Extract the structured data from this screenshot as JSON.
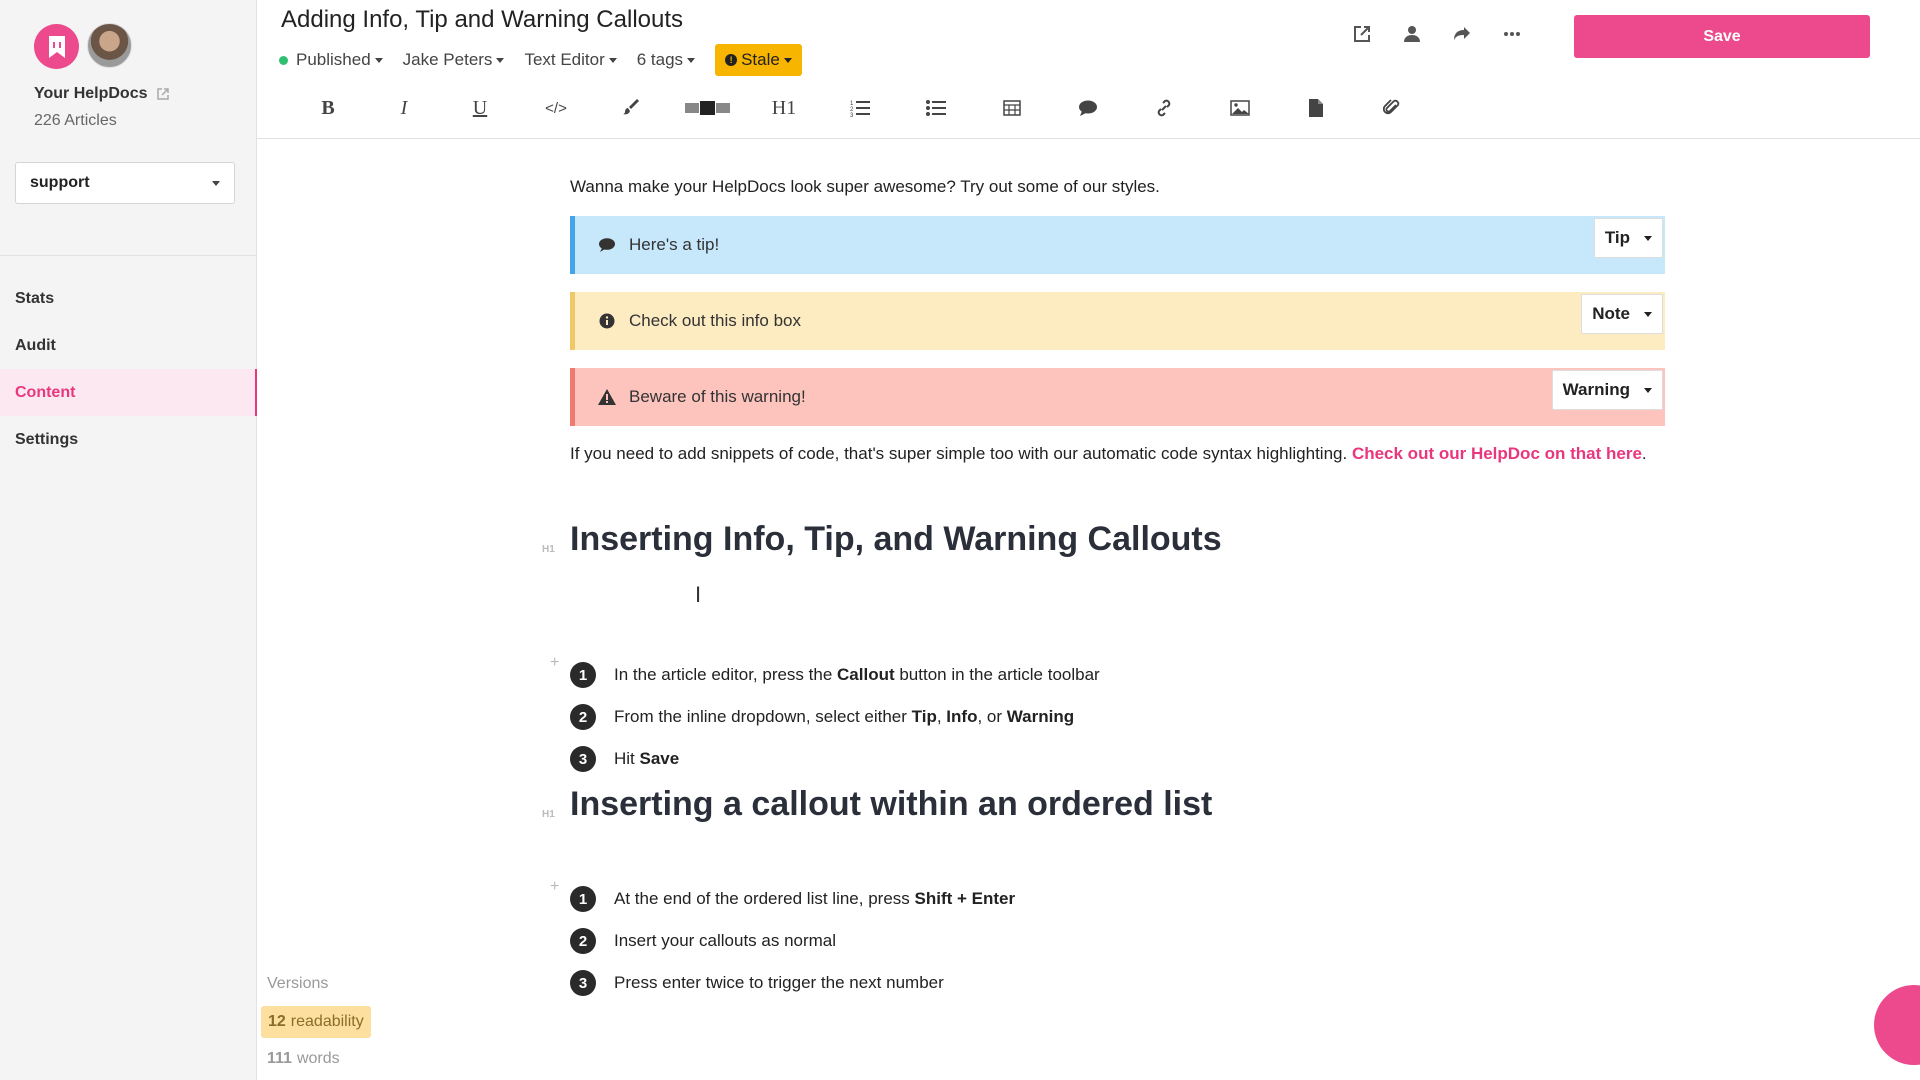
{
  "sidebar": {
    "brand": "Your HelpDocs",
    "article_count": "226 Articles",
    "workspace": "support",
    "nav": [
      {
        "label": "Stats"
      },
      {
        "label": "Audit"
      },
      {
        "label": "Content"
      },
      {
        "label": "Settings"
      }
    ],
    "versions": "Versions",
    "readability_value": "12",
    "readability_label": "readability",
    "words_value": "111",
    "words_label": "words"
  },
  "header": {
    "title": "Adding Info, Tip and Warning Callouts",
    "status": "Published",
    "author": "Jake Peters",
    "editor_mode": "Text Editor",
    "tags": "6 tags",
    "stale": "Stale",
    "save_label": "Save"
  },
  "toolbar": {
    "heading_label": "H1"
  },
  "content": {
    "intro": "Wanna make your HelpDocs look super awesome? Try out some of our styles.",
    "callouts": [
      {
        "text": "Here's a tip!",
        "type": "Tip"
      },
      {
        "text": "Check out this info box",
        "type": "Note"
      },
      {
        "text": "Beware of this warning!",
        "type": "Warning"
      }
    ],
    "snippet_text": "If you need to add snippets of code, that's super simple too with our automatic code syntax highlighting.  ",
    "snippet_link": "Check out our HelpDoc on that here",
    "snippet_end": ".",
    "h1_tag": "H1",
    "heading1": "Inserting Info, Tip, and Warning Callouts",
    "list1": [
      {
        "n": "1",
        "pre": "In the article editor, press the ",
        "b1": "Callout",
        "post": " button in the article toolbar"
      },
      {
        "n": "2",
        "pre": "From the inline dropdown, select either ",
        "b1": "Tip",
        "mid1": ", ",
        "b2": "Info",
        "mid2": ", or ",
        "b3": "Warning"
      },
      {
        "n": "3",
        "pre": "Hit ",
        "b1": "Save"
      }
    ],
    "heading2": "Inserting a callout within an ordered list",
    "list2": [
      {
        "n": "1",
        "pre": "At the end of the ordered list line, press ",
        "b1": "Shift + Enter"
      },
      {
        "n": "2",
        "pre": "Insert your callouts as normal"
      },
      {
        "n": "3",
        "pre": "Press enter twice to trigger the next number"
      }
    ]
  }
}
